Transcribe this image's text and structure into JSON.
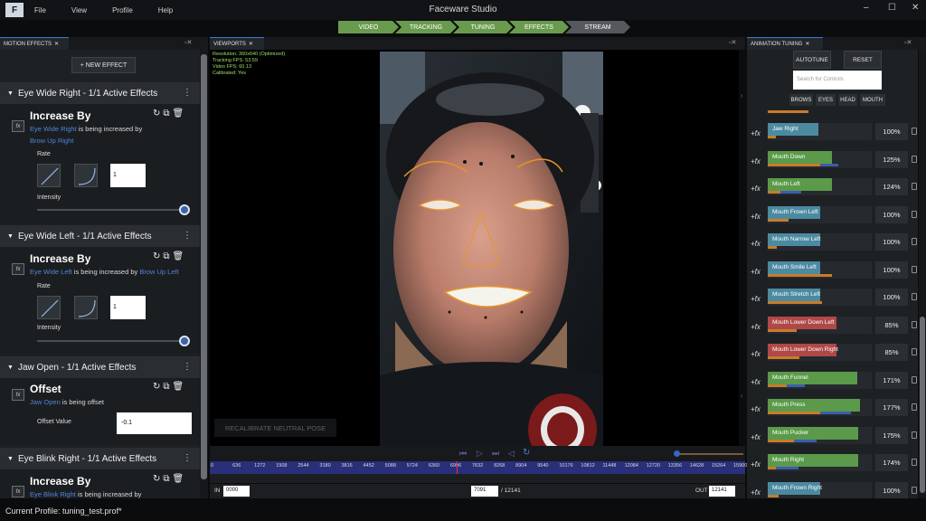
{
  "app": {
    "title": "Faceware Studio",
    "logo": "F"
  },
  "menu": [
    "File",
    "View",
    "Profile",
    "Help"
  ],
  "window_controls": [
    "–",
    "☐",
    "✕"
  ],
  "workflow": [
    "VIDEO",
    "TRACKING",
    "TUNING",
    "EFFECTS",
    "STREAM"
  ],
  "left_panel": {
    "tab": "MOTION EFFECTS",
    "new_effect": "+ NEW EFFECT",
    "effects": [
      {
        "header": "Eye Wide Right - 1/1 Active Effects",
        "title": "Increase By",
        "target": "Eye Wide Right",
        "mid": " is being increased by",
        "source": "Brow Up Right",
        "rate_label": "Rate",
        "rate_value": "1",
        "intensity_label": "Intensity"
      },
      {
        "header": "Eye Wide Left - 1/1 Active Effects",
        "title": "Increase By",
        "target": "Eye Wide Left",
        "mid": " is being increased by ",
        "source": "Brow Up Left",
        "rate_label": "Rate",
        "rate_value": "1",
        "intensity_label": "Intensity"
      },
      {
        "header": "Jaw Open - 1/1 Active Effects",
        "title": "Offset",
        "target": "Jaw Open",
        "mid": " is being offset",
        "offset_label": "Offset Value",
        "offset_value": "-0.1"
      },
      {
        "header": "Eye Blink Right - 1/1 Active Effects",
        "title": "Increase By",
        "target": "Eye Blink Right",
        "mid": " is being increased by"
      }
    ]
  },
  "viewport": {
    "tab": "VIEWPORTS",
    "info": [
      "Resolution: 360x640 (Optimized)",
      "Tracking FPS: 53.59",
      "Video FPS: 60.13",
      "Calibrated: Yes"
    ],
    "recalibrate": "RECALIBRATE NEUTRAL POSE"
  },
  "timeline": {
    "ticks": [
      "0",
      "636",
      "1272",
      "1908",
      "2544",
      "3180",
      "3816",
      "4452",
      "5088",
      "5724",
      "6360",
      "6996",
      "7632",
      "8268",
      "8904",
      "9540",
      "10176",
      "10812",
      "11448",
      "12084",
      "12720",
      "13356",
      "14628",
      "15264",
      "15900"
    ],
    "in_label": "IN",
    "in_value": "0000",
    "frame_value": "7091",
    "frame_total": "/ 12141",
    "out_label": "OUT",
    "out_value": "12141"
  },
  "right_panel": {
    "tab": "ANIMATION TUNING",
    "autotune": "AUTOTUNE",
    "reset": "RESET",
    "search_placeholder": "Search for Controls",
    "categories": [
      "BROWS",
      "EYES",
      "HEAD",
      "MOUTH"
    ],
    "controls": [
      {
        "name": "Jaw Right",
        "pct": "100%",
        "color": "#4b8aa0",
        "fill": 0.49,
        "orange": 0.08,
        "blue": 0.0
      },
      {
        "name": "Mouth Down",
        "pct": "125%",
        "color": "#5a9a4a",
        "fill": 0.62,
        "orange": 0.5,
        "blue": 0.68
      },
      {
        "name": "Mouth Left",
        "pct": "124%",
        "color": "#5a9a4a",
        "fill": 0.62,
        "orange": 0.12,
        "blue": 0.32
      },
      {
        "name": "Mouth Frown Left",
        "pct": "100%",
        "color": "#4b8aa0",
        "fill": 0.5,
        "orange": 0.2,
        "blue": 0.0
      },
      {
        "name": "Mouth Narrow Left",
        "pct": "100%",
        "color": "#4b8aa0",
        "fill": 0.5,
        "orange": 0.09,
        "blue": 0.0
      },
      {
        "name": "Mouth Smile Left",
        "pct": "100%",
        "color": "#4b8aa0",
        "fill": 0.5,
        "orange": 0.62,
        "blue": 0.0
      },
      {
        "name": "Mouth Stretch Left",
        "pct": "100%",
        "color": "#4b8aa0",
        "fill": 0.5,
        "orange": 0.52,
        "blue": 0.0
      },
      {
        "name": "Mouth Lower Down Left",
        "pct": "85%",
        "color": "#b04848",
        "fill": 0.66,
        "orange": 0.28,
        "blue": 0.0
      },
      {
        "name": "Mouth Lower Down Right",
        "pct": "85%",
        "color": "#b04848",
        "fill": 0.66,
        "orange": 0.3,
        "blue": 0.0
      },
      {
        "name": "Mouth Funnel",
        "pct": "171%",
        "color": "#5a9a4a",
        "fill": 0.86,
        "orange": 0.18,
        "blue": 0.36
      },
      {
        "name": "Mouth Press",
        "pct": "177%",
        "color": "#5a9a4a",
        "fill": 0.89,
        "orange": 0.5,
        "blue": 0.8
      },
      {
        "name": "Mouth Pucker",
        "pct": "175%",
        "color": "#5a9a4a",
        "fill": 0.87,
        "orange": 0.25,
        "blue": 0.47
      },
      {
        "name": "Mouth Right",
        "pct": "174%",
        "color": "#5a9a4a",
        "fill": 0.87,
        "orange": 0.08,
        "blue": 0.3
      },
      {
        "name": "Mouth Frown Right",
        "pct": "100%",
        "color": "#4b8aa0",
        "fill": 0.5,
        "orange": 0.1,
        "blue": 0.0
      }
    ]
  },
  "status": "Current Profile: tuning_test.prof*"
}
